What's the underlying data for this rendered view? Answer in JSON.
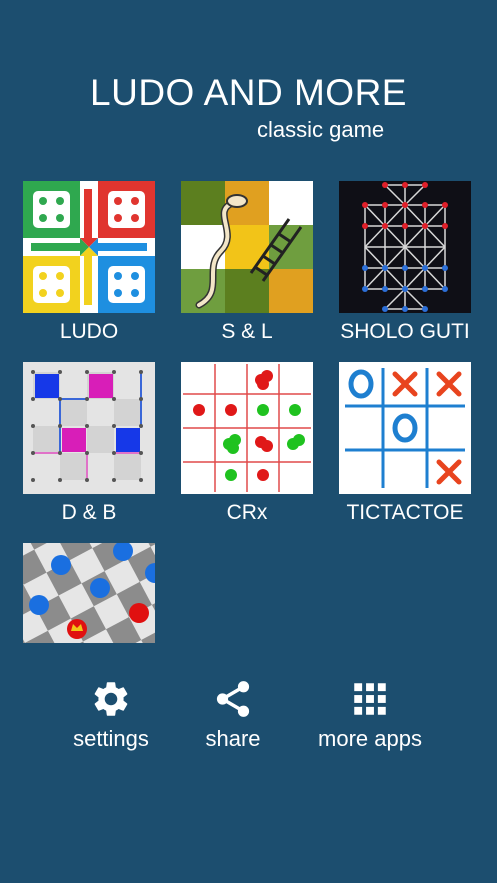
{
  "header": {
    "title": "LUDO AND MORE",
    "subtitle": "classic game"
  },
  "games": [
    {
      "label": "LUDO",
      "icon": "ludo-board-icon"
    },
    {
      "label": "S & L",
      "icon": "snakes-and-ladders-icon"
    },
    {
      "label": "SHOLO GUTI",
      "icon": "sholo-guti-board-icon"
    },
    {
      "label": "D & B",
      "icon": "dots-and-boxes-icon"
    },
    {
      "label": "CRx",
      "icon": "crx-grid-icon"
    },
    {
      "label": "TICTACTOE",
      "icon": "tictactoe-icon"
    },
    {
      "label": "",
      "icon": "checkers-board-icon"
    }
  ],
  "actions": {
    "settings": {
      "label": "settings",
      "icon": "gear-icon"
    },
    "share": {
      "label": "share",
      "icon": "share-icon"
    },
    "more_apps": {
      "label": "more apps",
      "icon": "grid-apps-icon"
    }
  },
  "colors": {
    "background": "#1c4e6f",
    "ludo_red": "#e0352f",
    "ludo_green": "#2fa84f",
    "ludo_yellow": "#f2d21e",
    "ludo_blue": "#1e8fe0",
    "tictactoe_o": "#1e7fd0",
    "tictactoe_x": "#e8441e"
  }
}
